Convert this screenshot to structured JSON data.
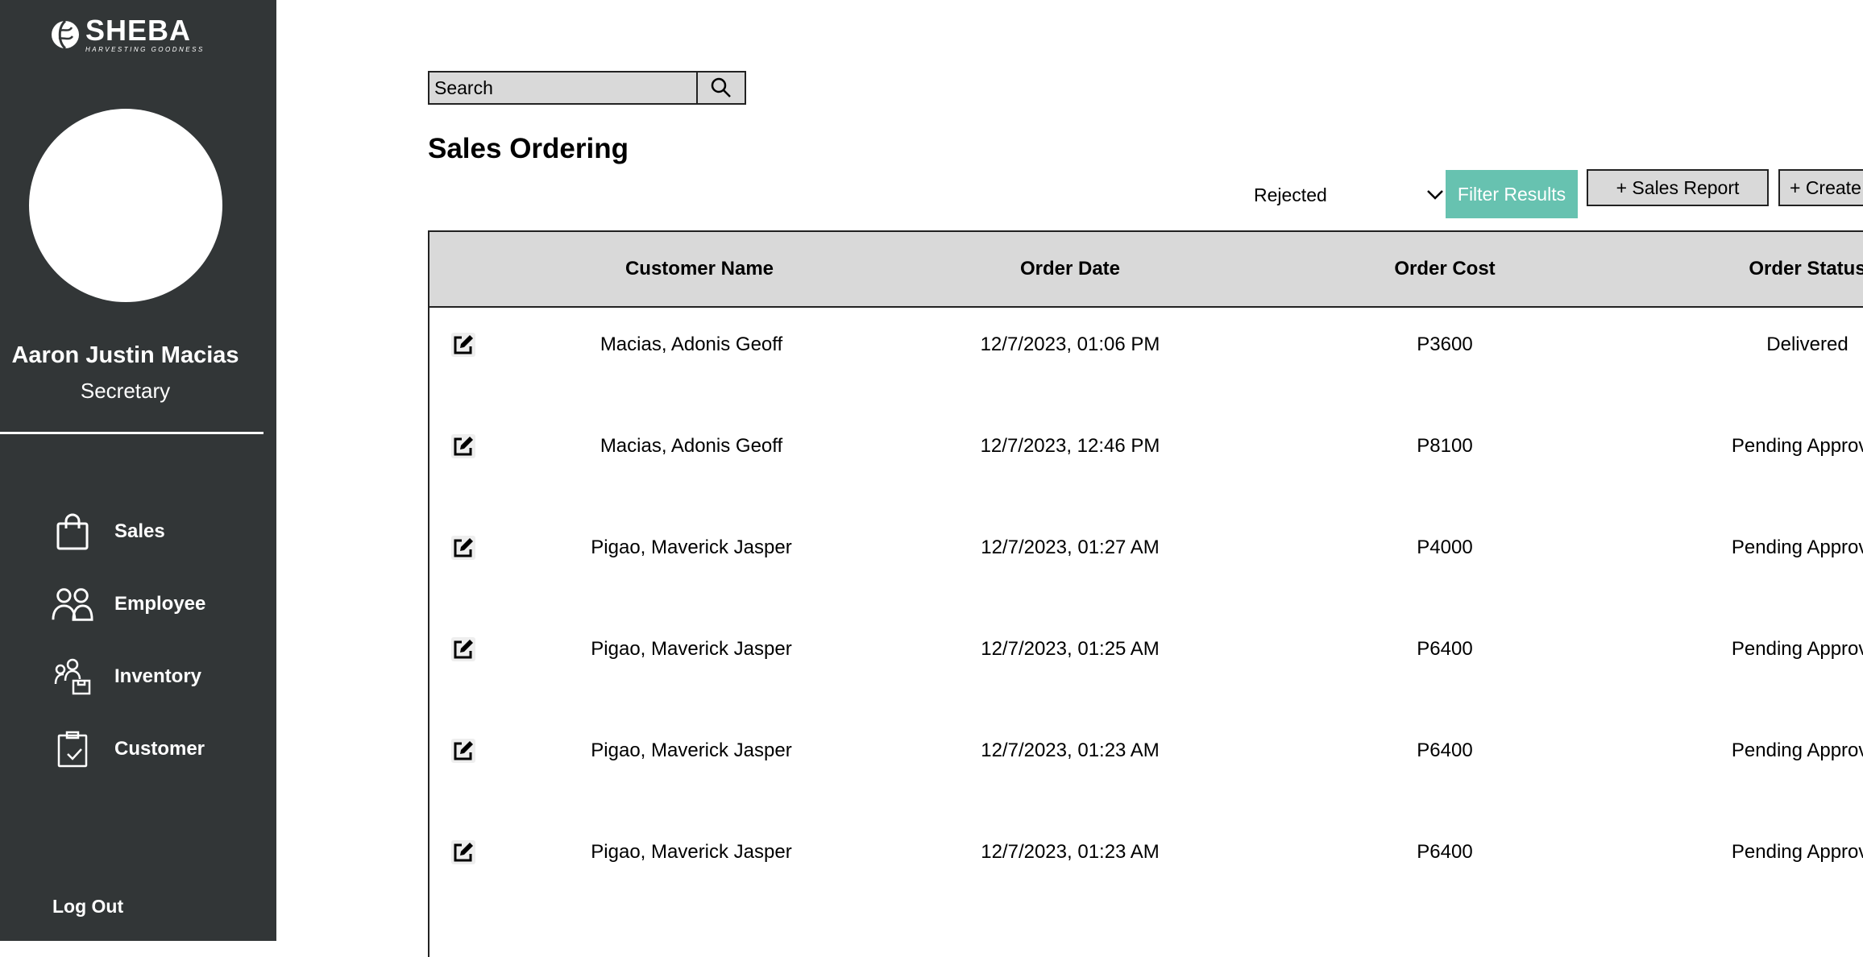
{
  "brand": {
    "name": "SHEBA",
    "tagline": "HARVESTING GOODNESS",
    "colors": {
      "sidebar": "#323637",
      "accent": "#67c2b0",
      "header": "#d9d9d9"
    }
  },
  "user": {
    "name": "Aaron Justin Macias",
    "role": "Secretary"
  },
  "sidebar": {
    "items": [
      {
        "label": "Sales",
        "icon": "shopping-bag-icon"
      },
      {
        "label": "Employee",
        "icon": "users-icon"
      },
      {
        "label": "Inventory",
        "icon": "inventory-icon"
      },
      {
        "label": "Customer",
        "icon": "clipboard-check-icon"
      }
    ],
    "logout": "Log Out"
  },
  "search": {
    "placeholder": "Search",
    "icon": "search-icon"
  },
  "page": {
    "title": "Sales Ordering"
  },
  "filter": {
    "selected": "Rejected",
    "button": "Filter Results"
  },
  "actions": {
    "sales_report": "+ Sales Report",
    "create": "+ Create"
  },
  "table": {
    "headers": [
      "Customer Name",
      "Order Date",
      "Order Cost",
      "Order Status"
    ],
    "rows": [
      {
        "customer": "Macias, Adonis Geoff",
        "date": "12/7/2023, 01:06 PM",
        "cost": "P3600",
        "status": "Delivered"
      },
      {
        "customer": "Macias, Adonis Geoff",
        "date": "12/7/2023, 12:46 PM",
        "cost": "P8100",
        "status": "Pending Approval"
      },
      {
        "customer": "Pigao, Maverick Jasper",
        "date": "12/7/2023, 01:27 AM",
        "cost": "P4000",
        "status": "Pending Approval"
      },
      {
        "customer": "Pigao, Maverick Jasper",
        "date": "12/7/2023, 01:25 AM",
        "cost": "P6400",
        "status": "Pending Approval"
      },
      {
        "customer": "Pigao, Maverick Jasper",
        "date": "12/7/2023, 01:23 AM",
        "cost": "P6400",
        "status": "Pending Approval"
      },
      {
        "customer": "Pigao, Maverick Jasper",
        "date": "12/7/2023, 01:23 AM",
        "cost": "P6400",
        "status": "Pending Approval"
      }
    ]
  }
}
